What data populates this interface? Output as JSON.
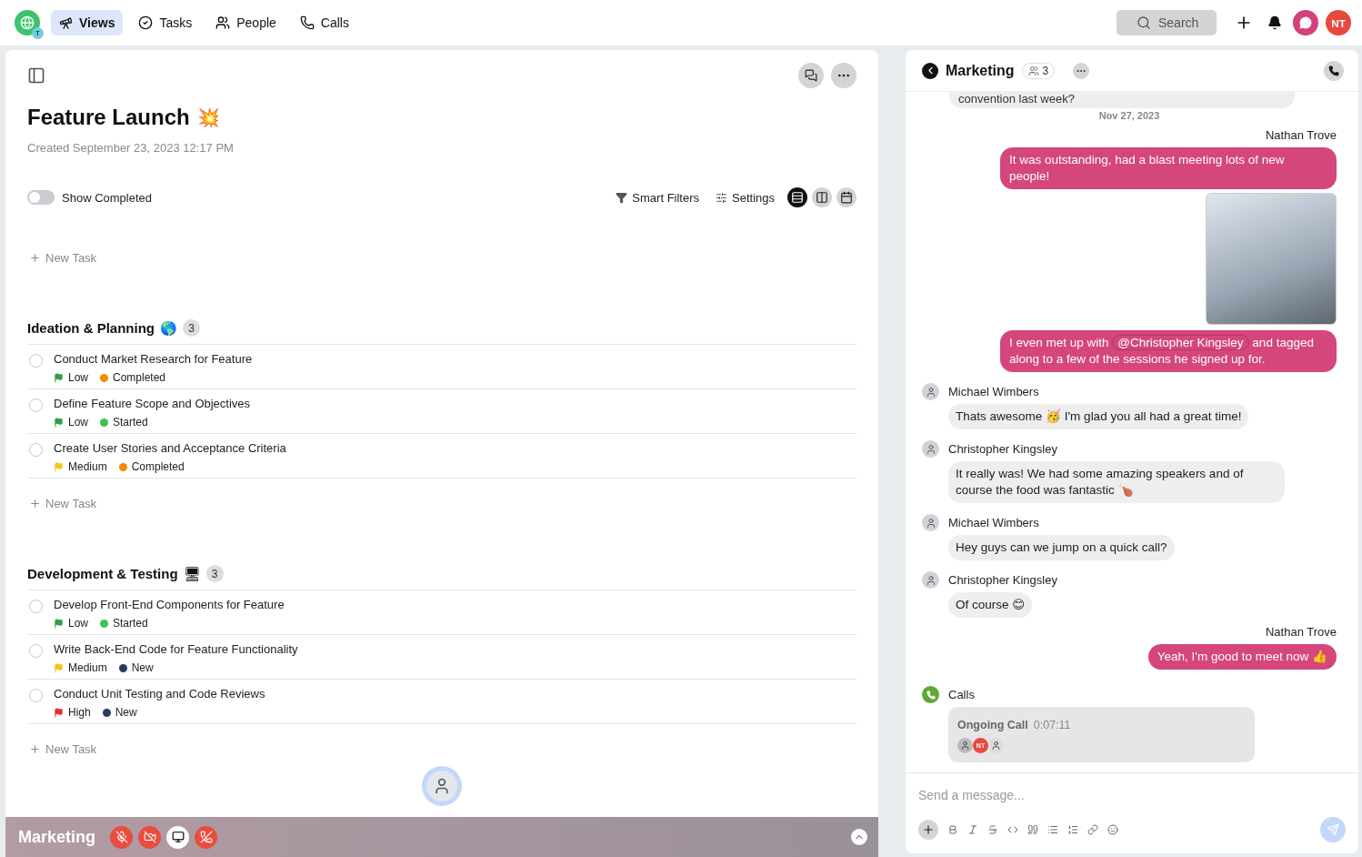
{
  "nav": {
    "tabs": [
      {
        "label": "Views",
        "selected": true
      },
      {
        "label": "Tasks",
        "selected": false
      },
      {
        "label": "People",
        "selected": false
      },
      {
        "label": "Calls",
        "selected": false
      }
    ],
    "workspace_badge": "T",
    "search": {
      "placeholder": "Search"
    },
    "user_initials": "NT"
  },
  "project": {
    "title": "Feature Launch",
    "emoji": "💥",
    "created": "Created September 23, 2023 12:17 PM"
  },
  "toolbar": {
    "show_completed": {
      "label": "Show Completed",
      "on": false
    },
    "smart_filters": "Smart Filters",
    "settings": "Settings",
    "views": [
      {
        "kind": "list",
        "selected": true
      },
      {
        "kind": "board",
        "selected": false
      },
      {
        "kind": "calendar",
        "selected": false
      }
    ]
  },
  "new_task": "New Task",
  "groups": [
    {
      "title": "Ideation & Planning",
      "emoji": "🌎",
      "count": "3",
      "new_task": "New Task",
      "tasks": [
        {
          "title": "Conduct Market Research for Feature",
          "priority": {
            "label": "Low",
            "color": "#2f9e44"
          },
          "status": {
            "label": "Completed",
            "color": "#f08c00"
          },
          "checked": false
        },
        {
          "title": "Define Feature Scope and Objectives",
          "priority": {
            "label": "Low",
            "color": "#2f9e44"
          },
          "status": {
            "label": "Started",
            "color": "#40c057"
          },
          "checked": false
        },
        {
          "title": "Create User Stories and Acceptance Criteria",
          "priority": {
            "label": "Medium",
            "color": "#f5c518"
          },
          "status": {
            "label": "Completed",
            "color": "#f08c00"
          },
          "checked": false
        }
      ]
    },
    {
      "title": "Development & Testing",
      "emoji": "🖥",
      "count": "3",
      "new_task": "New Task",
      "tasks": [
        {
          "title": "Develop Front-End Components for Feature",
          "priority": {
            "label": "Low",
            "color": "#2f9e44"
          },
          "status": {
            "label": "Started",
            "color": "#40c057"
          },
          "checked": false
        },
        {
          "title": "Write Back-End Code for Feature Functionality",
          "priority": {
            "label": "Medium",
            "color": "#f5c518"
          },
          "status": {
            "label": "New",
            "color": "#283c63"
          },
          "checked": false
        },
        {
          "title": "Conduct Unit Testing and Code Reviews",
          "priority": {
            "label": "High",
            "color": "#e03131"
          },
          "status": {
            "label": "New",
            "color": "#283c63"
          },
          "checked": false
        }
      ]
    }
  ],
  "call_bar": {
    "title": "Marketing",
    "controls": [
      {
        "kind": "mic_off"
      },
      {
        "kind": "video_off"
      },
      {
        "kind": "screen"
      },
      {
        "kind": "hangup"
      }
    ]
  },
  "chat": {
    "title": "Marketing",
    "members": "3",
    "messages": [
      {
        "kind": "incoming_cut",
        "text": "convention last week?"
      },
      {
        "kind": "date",
        "text": "Nov 27, 2023"
      },
      {
        "kind": "outgoing",
        "author": "Nathan Trove",
        "text": "It was outstanding, had a blast meeting lots of new people!"
      },
      {
        "kind": "outgoing_image"
      },
      {
        "kind": "outgoing_mention",
        "before": "I even met up with",
        "mention": "@Christopher Kingsley",
        "after": "and tagged along to a few of the sessions he signed up for."
      },
      {
        "kind": "incoming",
        "author": "Michael Wimbers",
        "text": "Thats awesome 🥳 I'm glad you all had a great time!"
      },
      {
        "kind": "incoming",
        "author": "Christopher Kingsley",
        "text": "It really was! We had some amazing speakers and of course the food was fantastic 🍗"
      },
      {
        "kind": "incoming",
        "author": "Michael Wimbers",
        "text": "Hey guys can we jump on a quick call?"
      },
      {
        "kind": "incoming",
        "author": "Christopher Kingsley",
        "text": "Of course 😊"
      },
      {
        "kind": "outgoing",
        "author": "Nathan Trove",
        "text": "Yeah, I'm good to meet now 👍"
      },
      {
        "kind": "call",
        "author": "Calls",
        "title": "Ongoing Call",
        "duration": "0:07:11",
        "participant_initials": "NT"
      }
    ],
    "composer": {
      "placeholder": "Send a message..."
    }
  }
}
